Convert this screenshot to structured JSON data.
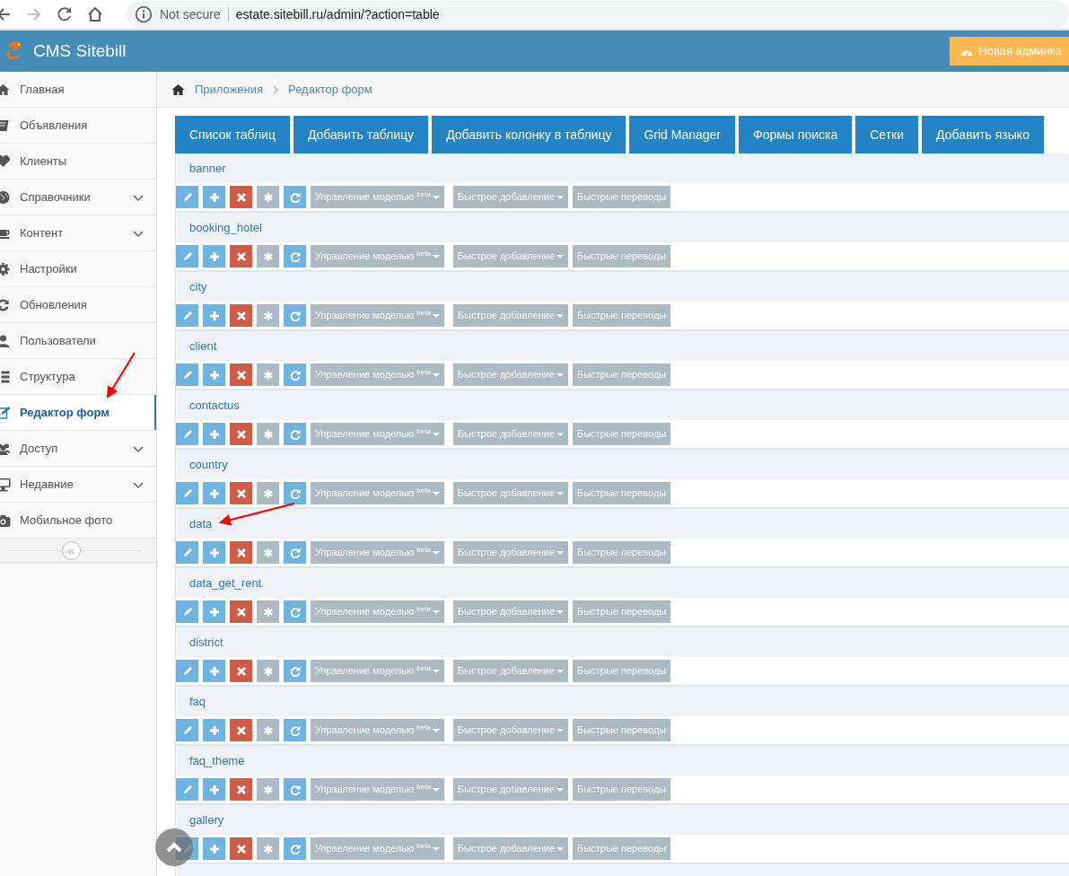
{
  "browser": {
    "nav": [
      {
        "kind": "back",
        "disabled": false
      },
      {
        "kind": "forward",
        "disabled": true
      },
      {
        "kind": "reload",
        "disabled": false
      },
      {
        "kind": "home",
        "disabled": false
      }
    ],
    "security": "Not secure",
    "url": "estate.sitebill.ru/admin/?action=table"
  },
  "header": {
    "title": "CMS Sitebill",
    "button": "Новая админка"
  },
  "sidebar": {
    "items": [
      {
        "label": "Главная",
        "selected": false,
        "expandable": false
      },
      {
        "label": "Объявления",
        "selected": false,
        "expandable": false
      },
      {
        "label": "Клиенты",
        "selected": false,
        "expandable": false
      },
      {
        "label": "Справочники",
        "selected": false,
        "expandable": true
      },
      {
        "label": "Контент",
        "selected": false,
        "expandable": true
      },
      {
        "label": "Настройки",
        "selected": false,
        "expandable": false
      },
      {
        "label": "Обновления",
        "selected": false,
        "expandable": false
      },
      {
        "label": "Пользователи",
        "selected": false,
        "expandable": false
      },
      {
        "label": "Структура",
        "selected": false,
        "expandable": false
      },
      {
        "label": "Редактор форм",
        "selected": true,
        "expandable": false
      },
      {
        "label": "Доступ",
        "selected": false,
        "expandable": true
      },
      {
        "label": "Недавние",
        "selected": false,
        "expandable": true
      },
      {
        "label": "Мобильное фото",
        "selected": false,
        "expandable": false
      }
    ],
    "collapse": "«"
  },
  "breadcrumb": [
    "Приложения",
    "Редактор форм"
  ],
  "toolbar": [
    "Список таблиц",
    "Добавить таблицу",
    "Добавить колонку в таблицу",
    "Grid Manager",
    "Формы поиска",
    "Сетки",
    "Добавить языко"
  ],
  "tables": [
    {
      "name": "banner",
      "model": "Управление моделью $^{beta}$",
      "quick_add": "Быстрое добавление",
      "translations": "Быстрые переводы"
    },
    {
      "name": "booking_hotel",
      "model": "Управление моделью $^{beta}$",
      "quick_add": "Быстрое добавление",
      "translations": "Быстрые переводы"
    },
    {
      "name": "city",
      "model": "Управление моделью $^{beta}$",
      "quick_add": "Быстрое добавление",
      "translations": "Быстрые переводы"
    },
    {
      "name": "client",
      "model": "Управление моделью $^{beta}$",
      "quick_add": "Быстрое добавление",
      "translations": "Быстрые переводы"
    },
    {
      "name": "contactus",
      "model": "Управление моделью $^{beta}$",
      "quick_add": "Быстрое добавление",
      "translations": "Быстрые переводы"
    },
    {
      "name": "country",
      "model": "Управление моделью $^{beta}$",
      "quick_add": "Быстрое добавление",
      "translations": "Быстрые переводы"
    },
    {
      "name": "data",
      "model": "Управление моделью $^{beta}$",
      "quick_add": "Быстрое добавление",
      "translations": "Быстрые переводы"
    },
    {
      "name": "data_get_rent",
      "model": "Управление моделью $^{beta}$",
      "quick_add": "Быстрое добавление",
      "translations": "Быстрые переводы"
    },
    {
      "name": "district",
      "model": "Управление моделью $^{beta}$",
      "quick_add": "Быстрое добавление",
      "translations": "Быстрые переводы"
    },
    {
      "name": "faq",
      "model": "Управление моделью $^{beta}$",
      "quick_add": "Быстрое добавление",
      "translations": "Быстрые переводы"
    },
    {
      "name": "faq_theme",
      "model": "Управление моделью $^{beta}$",
      "quick_add": "Быстрое добавление",
      "translations": "Быстрые переводы"
    },
    {
      "name": "gallery",
      "model": "Управление моделью $^{beta}$",
      "quick_add": "Быстрое добавление",
      "translations": "Быстрые переводы"
    }
  ]
}
